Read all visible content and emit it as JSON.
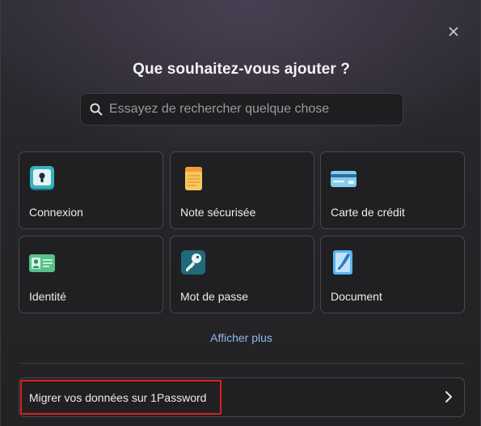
{
  "dialog": {
    "title": "Que souhaitez-vous ajouter ?",
    "close_icon": "close-icon"
  },
  "search": {
    "placeholder": "Essayez de rechercher quelque chose",
    "value": "",
    "icon": "search-icon"
  },
  "categories": [
    {
      "label": "Connexion",
      "icon": "keyhole-icon",
      "color": "#35a7b6"
    },
    {
      "label": "Note sécurisée",
      "icon": "notepad-icon",
      "color": "#f6c35a"
    },
    {
      "label": "Carte de crédit",
      "icon": "credit-card-icon",
      "color": "#7cc8ee"
    },
    {
      "label": "Identité",
      "icon": "id-card-icon",
      "color": "#4fbf86"
    },
    {
      "label": "Mot de passe",
      "icon": "key-icon",
      "color": "#1f6b7a"
    },
    {
      "label": "Document",
      "icon": "document-pen-icon",
      "color": "#5ab4f0"
    }
  ],
  "show_more": "Afficher plus",
  "migrate": {
    "label": "Migrer vos données sur 1Password",
    "icon": "chevron-right-icon"
  },
  "colors": {
    "link": "#8fb7ee",
    "highlight": "#e01e1e",
    "card_border": "#48484d"
  }
}
